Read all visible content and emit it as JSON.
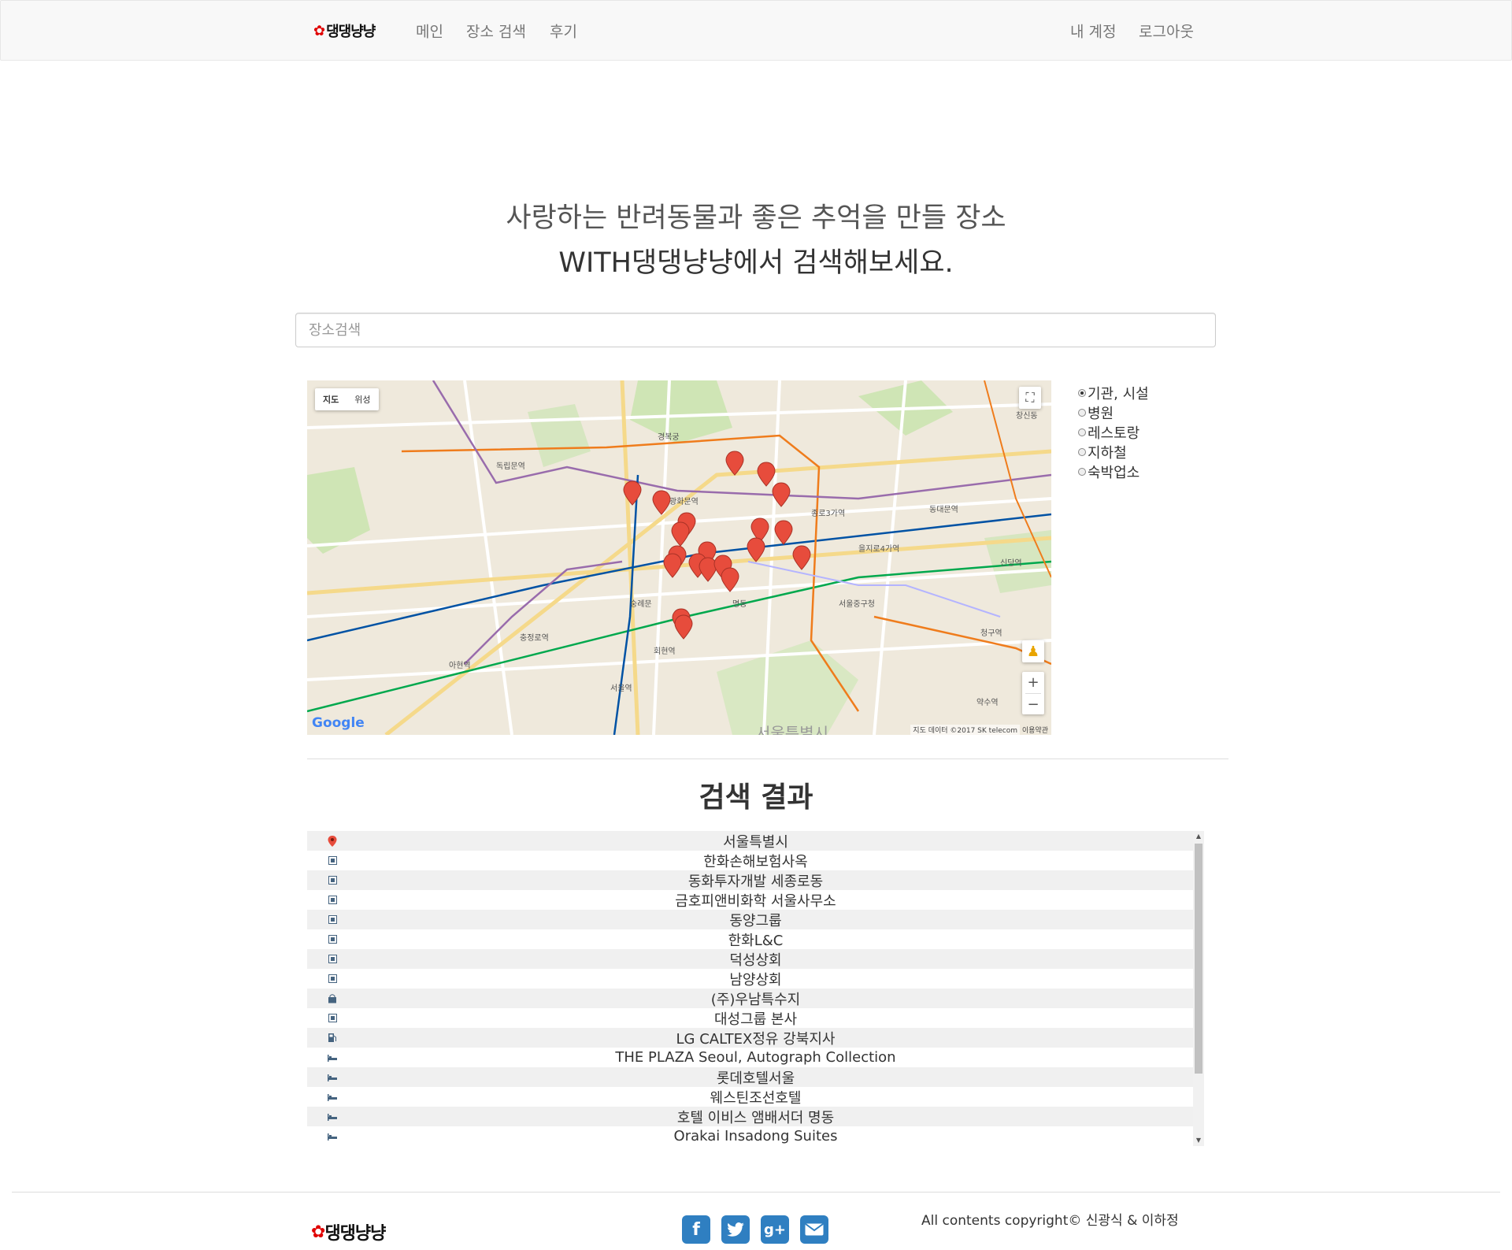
{
  "navbar": {
    "brand": "댕댕냥냥",
    "links": [
      "메인",
      "장소 검색",
      "후기"
    ],
    "account": "내 계정",
    "logout": "로그아웃"
  },
  "hero": {
    "line1": "사랑하는 반려동물과 좋은 추억을 만들 장소",
    "line2": "WITH댕댕냥냥에서 검색해보세요."
  },
  "search": {
    "placeholder": "장소검색",
    "value": ""
  },
  "map": {
    "type_buttons": [
      "지도",
      "위성"
    ],
    "attribution": "지도 데이터 ©2017 SK telecom",
    "terms": "이용약관",
    "google": "Google",
    "zoom_in": "+",
    "zoom_out": "−",
    "labels": [
      "서울특별시",
      "종로3가역",
      "을지로4가역",
      "회현역",
      "서울역",
      "동대문역",
      "경복궁",
      "광화문역",
      "충정로역",
      "아현역",
      "신당역",
      "약수역",
      "명동",
      "서울중구청",
      "청구역",
      "독립문역",
      "창신동",
      "숭례문"
    ]
  },
  "categories": [
    {
      "label": "기관, 시설",
      "checked": true
    },
    {
      "label": "병원",
      "checked": false
    },
    {
      "label": "레스토랑",
      "checked": false
    },
    {
      "label": "지하철",
      "checked": false
    },
    {
      "label": "숙박업소",
      "checked": false
    }
  ],
  "results_title": "검색 결과",
  "results": [
    {
      "name": "서울특별시",
      "icon": "location-pin-icon"
    },
    {
      "name": "한화손해보험사옥",
      "icon": "building-icon"
    },
    {
      "name": "동화투자개발 세종로동",
      "icon": "building-icon"
    },
    {
      "name": "금호피앤비화학 서울사무소",
      "icon": "building-icon"
    },
    {
      "name": "동양그룹",
      "icon": "building-icon"
    },
    {
      "name": "한화L&C",
      "icon": "building-icon"
    },
    {
      "name": "덕성상회",
      "icon": "building-icon"
    },
    {
      "name": "남양상회",
      "icon": "building-icon"
    },
    {
      "name": "(주)우남특수지",
      "icon": "shop-icon"
    },
    {
      "name": "대성그룹 본사",
      "icon": "building-icon"
    },
    {
      "name": "LG CALTEX정유 강북지사",
      "icon": "gas-station-icon"
    },
    {
      "name": "THE PLAZA Seoul, Autograph Collection",
      "icon": "bed-icon"
    },
    {
      "name": "롯데호텔서울",
      "icon": "bed-icon"
    },
    {
      "name": "웨스틴조선호텔",
      "icon": "bed-icon"
    },
    {
      "name": "호텔 이비스 앰배서더 명동",
      "icon": "bed-icon"
    },
    {
      "name": "Orakai Insadong Suites",
      "icon": "bed-icon"
    }
  ],
  "footer": {
    "brand": "댕댕냥냥",
    "social": [
      "facebook-icon",
      "twitter-icon",
      "google-plus-icon",
      "email-icon"
    ],
    "copyright": "All contents copyright© 신광식 & 이하정"
  },
  "colors": {
    "pin": "#e74c3c",
    "social": "#2f7fc1",
    "brand_paw": "#e00000"
  }
}
